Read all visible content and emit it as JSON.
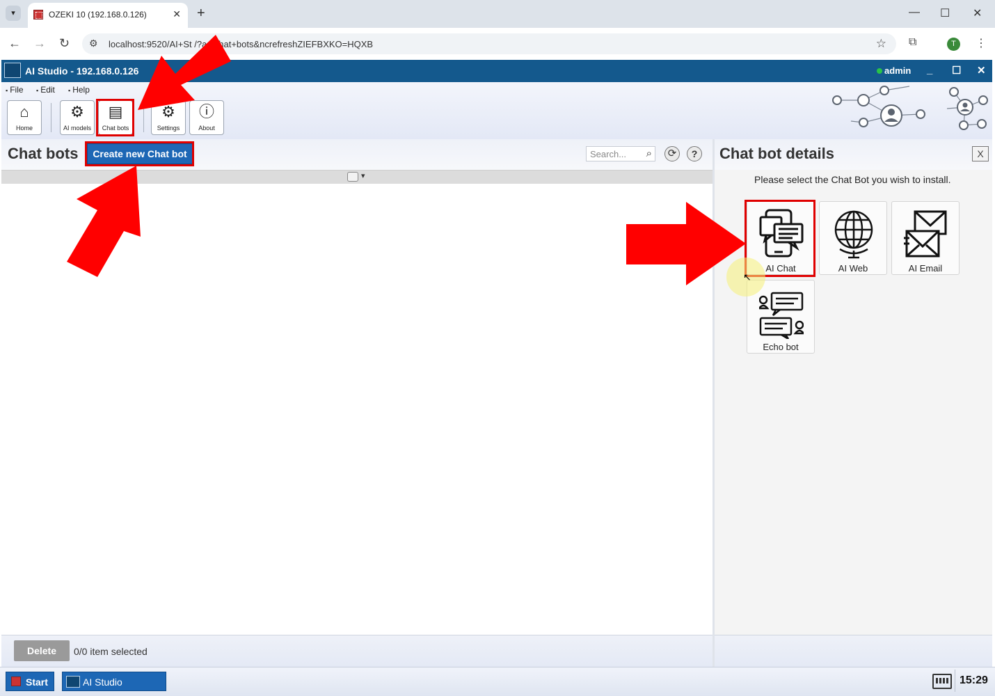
{
  "browser": {
    "tab_title": "OZEKI 10 (192.168.0.126)",
    "tab_close": "✕",
    "new_tab": "+",
    "url": "localhost:9520/AI+St    /?a=Chat+bots&ncrefreshZIEFBXKO=HQXB",
    "profile_initial": "T",
    "window_controls": [
      "—",
      "☐",
      "✕"
    ]
  },
  "app": {
    "title": "AI Studio - 192.168.0.126",
    "user": "admin",
    "controls": [
      "_",
      "☐",
      "✕"
    ],
    "menu": [
      "File",
      "Edit",
      "Help"
    ],
    "toolbar": [
      {
        "label": "Home",
        "icon": "home-icon"
      },
      {
        "label": "AI models",
        "icon": "gear-brain-icon"
      },
      {
        "label": "Chat bots",
        "icon": "chat-bots-icon"
      },
      {
        "label": "Settings",
        "icon": "settings-gear-icon"
      },
      {
        "label": "About",
        "icon": "info-icon"
      }
    ]
  },
  "left_panel": {
    "title": "Chat bots",
    "create_button": "Create new Chat bot",
    "search_placeholder": "Search...",
    "delete_button": "Delete",
    "selection_status": "0/0 item selected"
  },
  "right_panel": {
    "title": "Chat bot details",
    "close": "X",
    "hint": "Please select the Chat Bot you wish to install.",
    "bots": [
      {
        "label": "AI Chat",
        "icon": "ai-chat-icon"
      },
      {
        "label": "AI Web",
        "icon": "globe-icon"
      },
      {
        "label": "AI Email",
        "icon": "email-icon"
      },
      {
        "label": "Echo bot",
        "icon": "echo-bot-icon"
      }
    ]
  },
  "taskbar": {
    "start": "Start",
    "app": "AI Studio",
    "time": "15:29"
  },
  "colors": {
    "app_header": "#14598d",
    "primary_button": "#1d67b5",
    "annotation_red": "#e00000"
  }
}
